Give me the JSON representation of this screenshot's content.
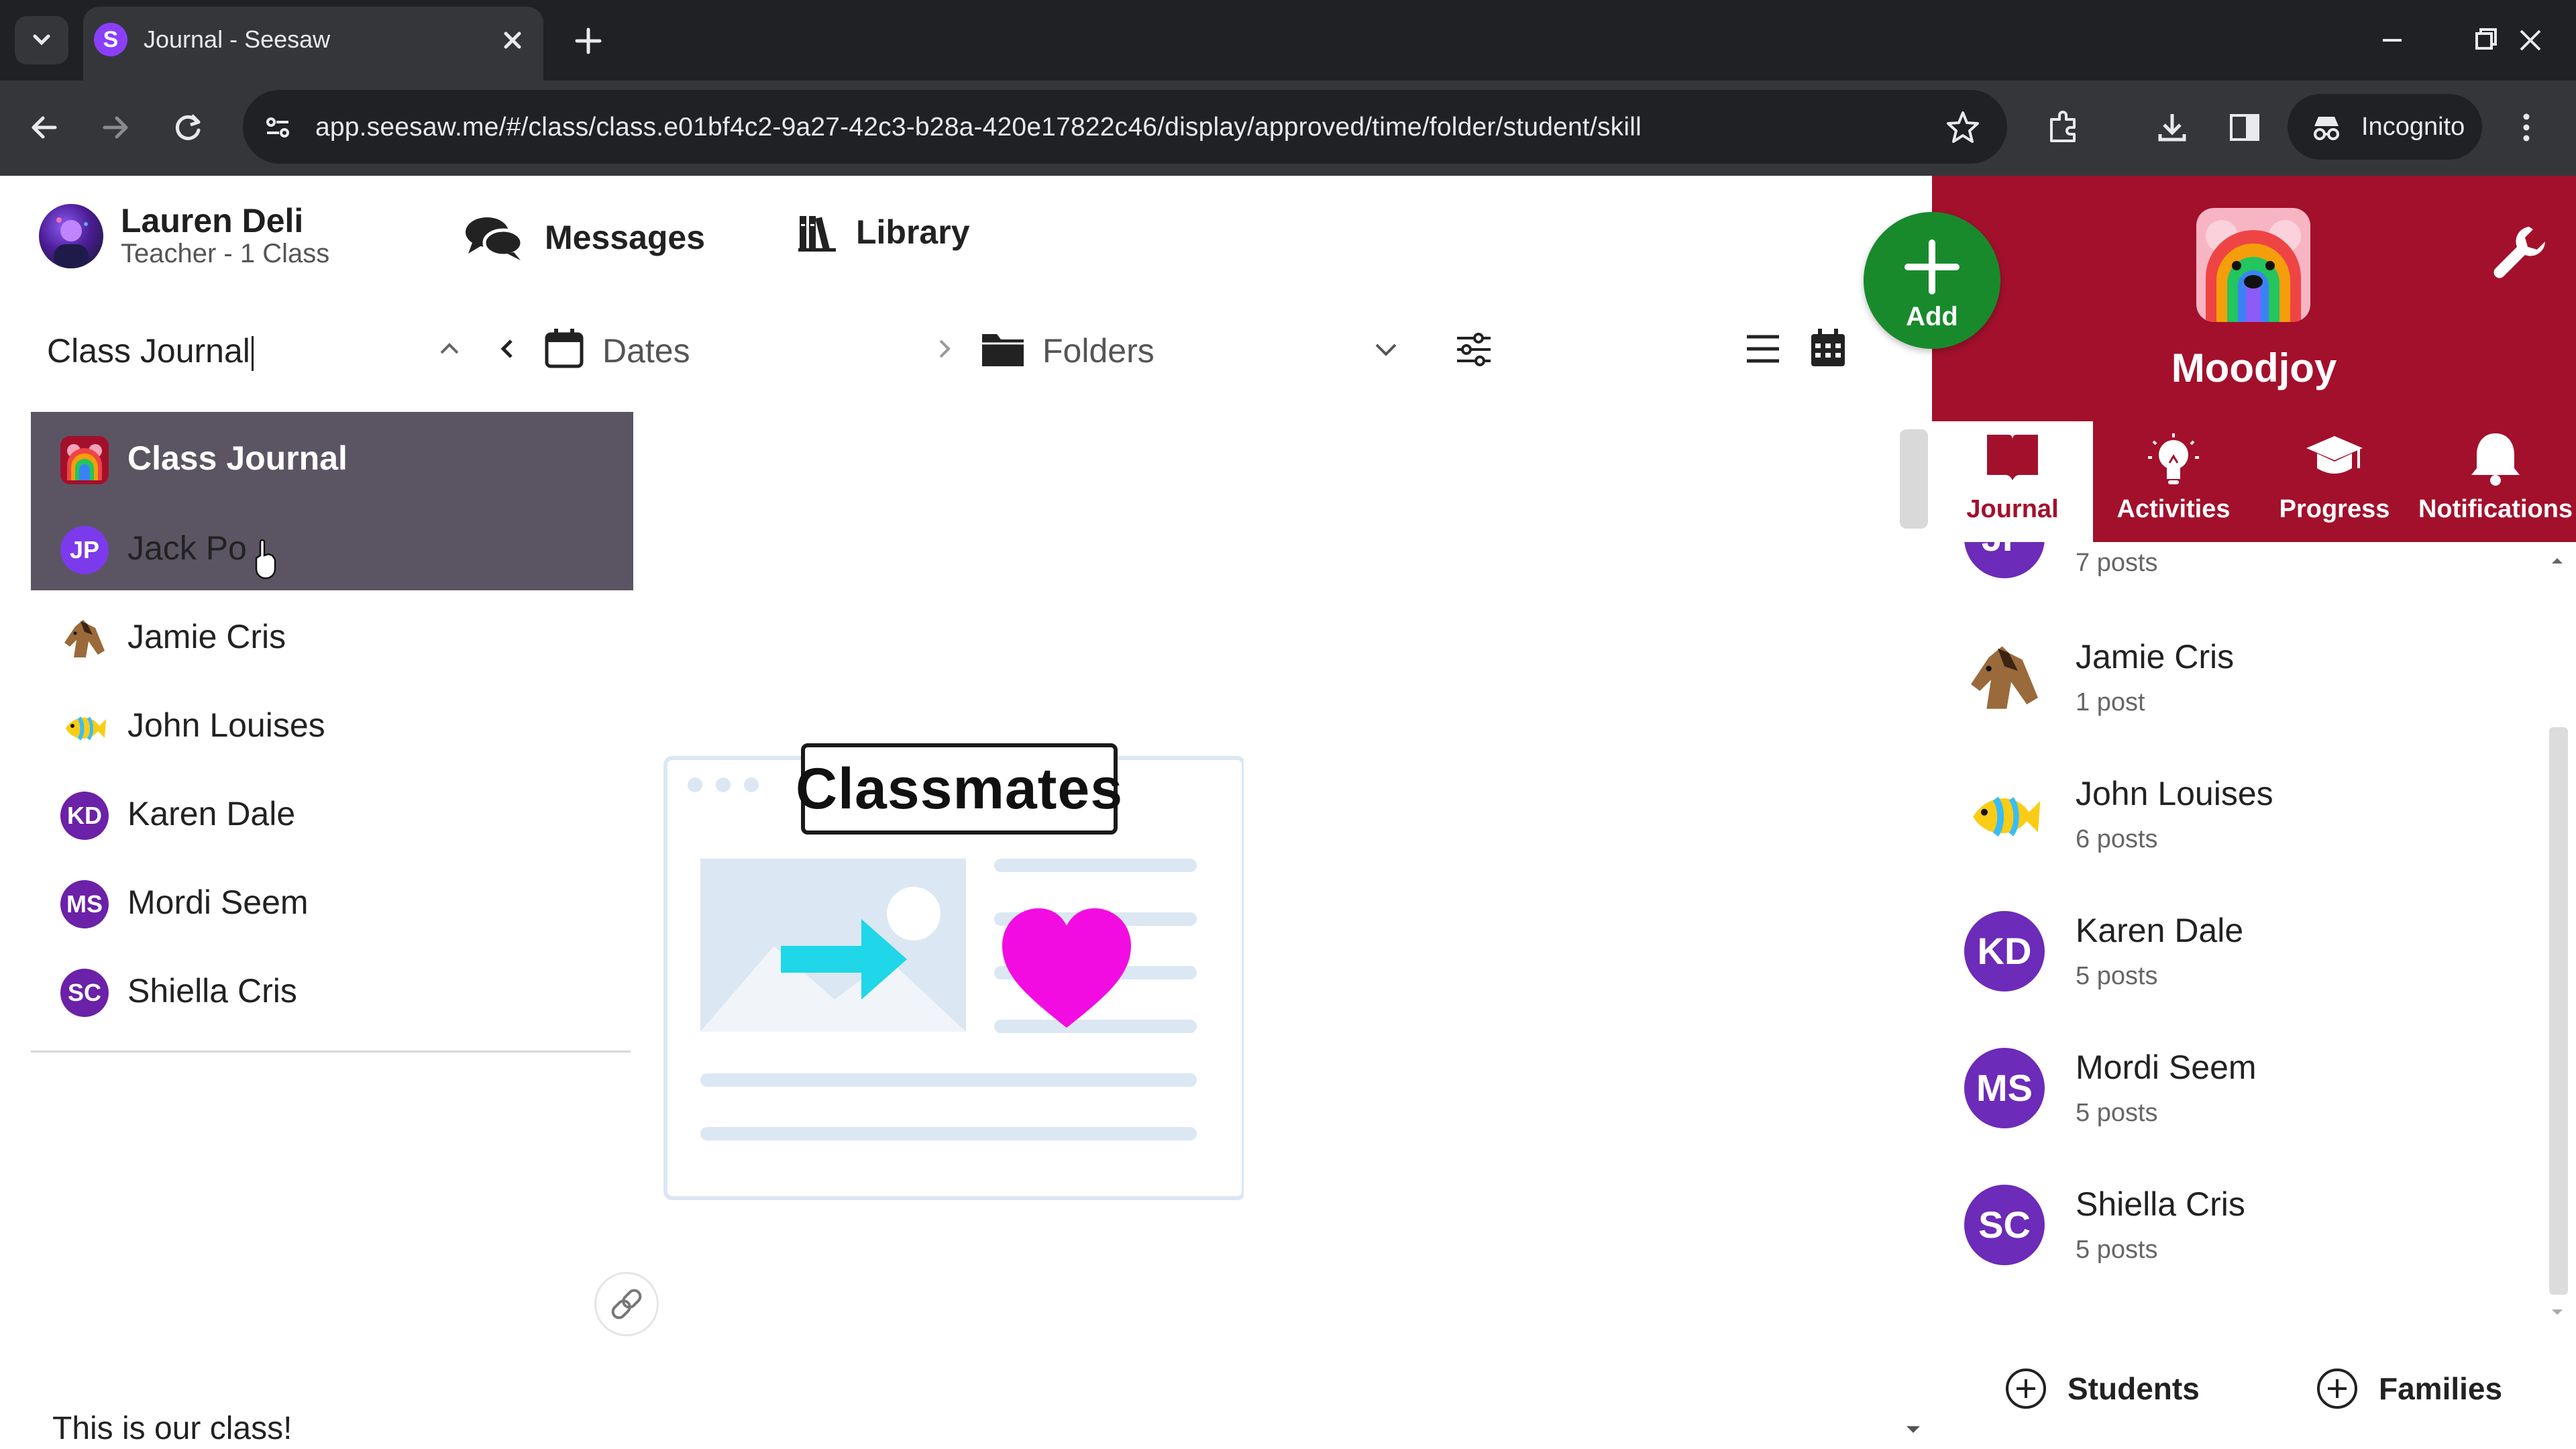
{
  "browser": {
    "tab_title": "Journal - Seesaw",
    "favicon_letter": "S",
    "url": "app.seesaw.me/#/class/class.e01bf4c2-9a27-42c3-b28a-420e17822c46/display/approved/time/folder/student/skill",
    "incognito_label": "Incognito"
  },
  "header": {
    "user_name": "Lauren Deli",
    "user_role": "Teacher - 1 Class",
    "messages_label": "Messages",
    "library_label": "Library"
  },
  "filters": {
    "class_input": "Class Journal",
    "dates_label": "Dates",
    "folders_label": "Folders"
  },
  "dropdown": {
    "items": [
      {
        "label": "Class Journal",
        "initials": "",
        "icon": "rainbow-bear-icon"
      },
      {
        "label": "Jack Po",
        "initials": "JP",
        "icon": ""
      },
      {
        "label": "Jamie Cris",
        "initials": "",
        "icon": "horse-icon"
      },
      {
        "label": "John Louises",
        "initials": "",
        "icon": "fish-icon"
      },
      {
        "label": "Karen Dale",
        "initials": "KD",
        "icon": ""
      },
      {
        "label": "Mordi Seem",
        "initials": "MS",
        "icon": ""
      },
      {
        "label": "Shiella Cris",
        "initials": "SC",
        "icon": ""
      }
    ]
  },
  "main": {
    "illustration_title": "Classmates",
    "caption": "This is our class!"
  },
  "right_panel": {
    "add_label": "Add",
    "class_name": "Moodjoy",
    "tabs": [
      {
        "label": "Journal",
        "icon": "book-icon"
      },
      {
        "label": "Activities",
        "icon": "lightbulb-icon"
      },
      {
        "label": "Progress",
        "icon": "graduation-cap-icon"
      },
      {
        "label": "Notifications",
        "icon": "bell-icon"
      }
    ],
    "students": [
      {
        "initials": "JP",
        "name": "",
        "posts": "7 posts"
      },
      {
        "initials": "",
        "icon": "horse-icon",
        "name": "Jamie Cris",
        "posts": "1 post"
      },
      {
        "initials": "",
        "icon": "fish-icon",
        "name": "John Louises",
        "posts": "6 posts"
      },
      {
        "initials": "KD",
        "name": "Karen Dale",
        "posts": "5 posts"
      },
      {
        "initials": "MS",
        "name": "Mordi Seem",
        "posts": "5 posts"
      },
      {
        "initials": "SC",
        "name": "Shiella Cris",
        "posts": "5 posts"
      }
    ],
    "students_button": "Students",
    "families_button": "Families"
  },
  "colors": {
    "brand_red": "#a3102c",
    "add_green": "#188a2c",
    "avatar_purple": "#6c2bb8",
    "selected_row": "#5b5563"
  }
}
